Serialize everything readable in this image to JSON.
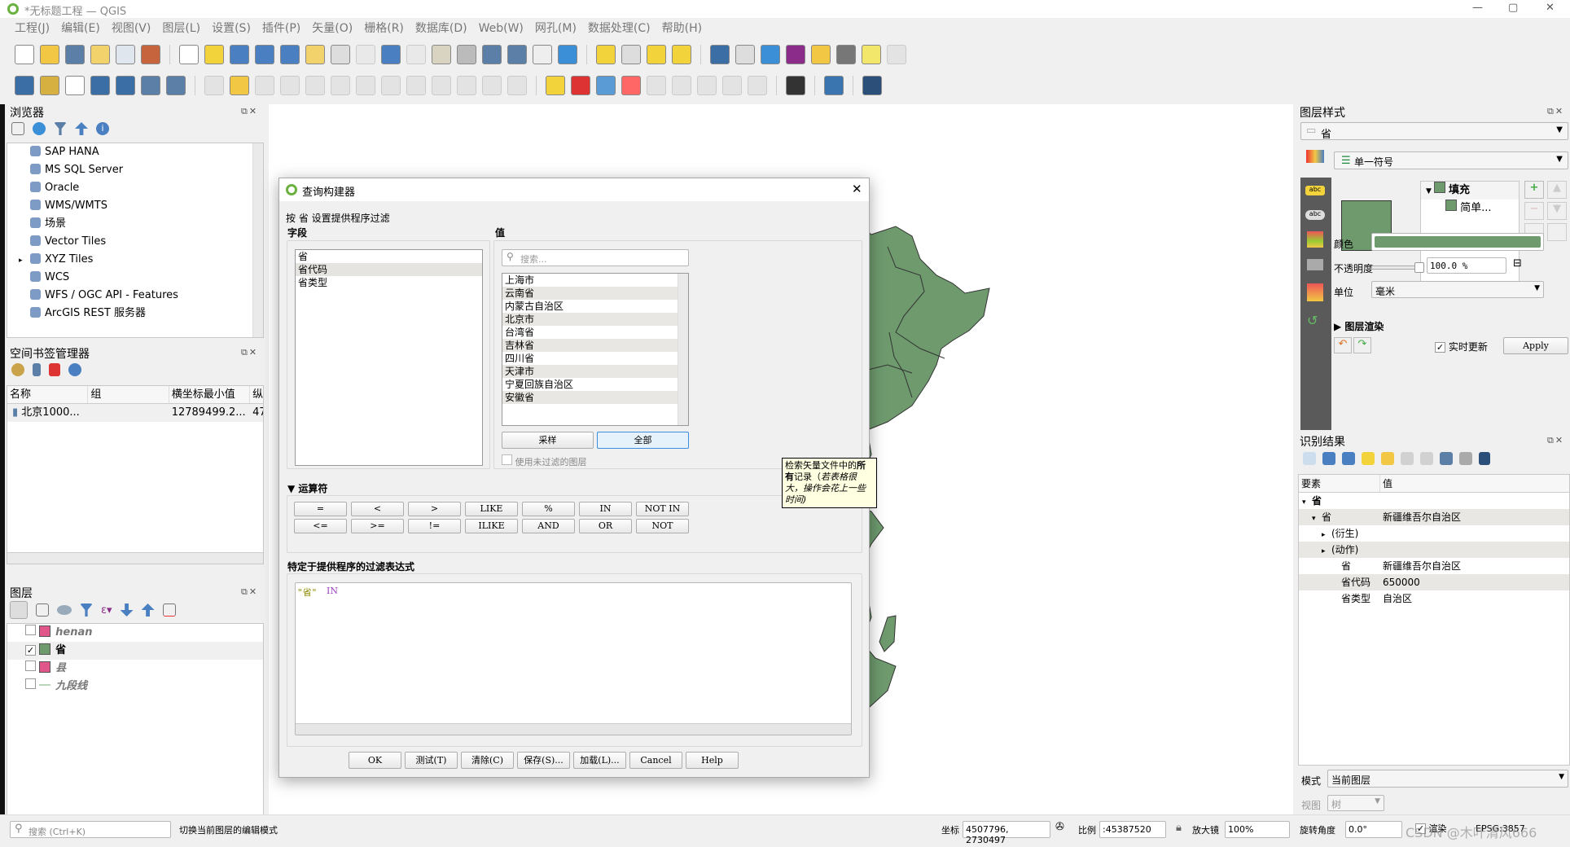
{
  "window": {
    "title": "*无标题工程 — QGIS",
    "minimize": "—",
    "maximize": "▢",
    "close": "✕"
  },
  "menu": [
    "工程(J)",
    "编辑(E)",
    "视图(V)",
    "图层(L)",
    "设置(S)",
    "插件(P)",
    "矢量(O)",
    "栅格(R)",
    "数据库(D)",
    "Web(W)",
    "网孔(M)",
    "数据处理(C)",
    "帮助(H)"
  ],
  "toolbar1": [
    {
      "icon": "new-project-icon",
      "color": "#fff"
    },
    {
      "icon": "open-project-icon",
      "color": "#f2c744"
    },
    {
      "icon": "save-project-icon",
      "color": "#5b7fa6"
    },
    {
      "icon": "new-print-layout-icon",
      "color": "#f2d36b"
    },
    {
      "icon": "layout-manager-icon",
      "color": "#dfe6ee"
    },
    {
      "icon": "style-manager-icon",
      "color": "#c6653d"
    },
    "sep",
    {
      "icon": "pan-icon",
      "color": "#fff"
    },
    {
      "icon": "pan-to-selection-icon",
      "color": "#f2d33c"
    },
    {
      "icon": "zoom-in-icon",
      "color": "#4a7fc1"
    },
    {
      "icon": "zoom-out-icon",
      "color": "#4a7fc1"
    },
    {
      "icon": "zoom-full-icon",
      "color": "#4a7fc1"
    },
    {
      "icon": "zoom-to-selection-icon",
      "color": "#f2d36b"
    },
    {
      "icon": "zoom-to-layer-icon",
      "color": "#ddd"
    },
    {
      "icon": "zoom-native-icon",
      "color": "#ddd",
      "dim": true
    },
    {
      "icon": "zoom-last-icon",
      "color": "#4a7fc1"
    },
    {
      "icon": "zoom-next-icon",
      "color": "#ddd",
      "dim": true
    },
    {
      "icon": "new-map-view-icon",
      "color": "#d9d3c1"
    },
    {
      "icon": "new-3d-view-icon",
      "color": "#bbb"
    },
    {
      "icon": "new-bookmark-icon",
      "color": "#5b7fa6"
    },
    {
      "icon": "show-bookmarks-icon",
      "color": "#5b7fa6"
    },
    {
      "icon": "temporal-controller-icon",
      "color": "#eee"
    },
    {
      "icon": "refresh-icon",
      "color": "#3a8fd6"
    },
    "sep",
    {
      "icon": "select-features-icon",
      "color": "#f2d33c"
    },
    {
      "icon": "attribute-table-icon",
      "color": "#ddd"
    },
    {
      "icon": "deselect-icon",
      "color": "#f2d33c"
    },
    {
      "icon": "select-by-location-icon",
      "color": "#f2d33c"
    },
    "sep",
    {
      "icon": "identify-icon",
      "color": "#3a6ea5"
    },
    {
      "icon": "open-table-icon",
      "color": "#ddd"
    },
    {
      "icon": "processing-toolbox-icon",
      "color": "#3a8fd6"
    },
    {
      "icon": "statistics-icon",
      "color": "#8b2c8b"
    },
    {
      "icon": "field-calculator-icon",
      "color": "#f2c744"
    },
    {
      "icon": "measure-icon",
      "color": "#777"
    },
    {
      "icon": "map-tips-icon",
      "color": "#f2e66b"
    },
    {
      "icon": "locator-icon",
      "color": "#ccc",
      "dim": true
    }
  ],
  "toolbar2": [
    {
      "icon": "data-source-manager-icon",
      "color": "#3a6ea5"
    },
    {
      "icon": "add-vector-layer-icon",
      "color": "#d6b040"
    },
    {
      "icon": "new-shapefile-icon",
      "color": "#fff"
    },
    {
      "icon": "new-geopackage-icon",
      "color": "#3a6ea5"
    },
    {
      "icon": "new-temp-layer-icon",
      "color": "#3a6ea5"
    },
    {
      "icon": "new-virtual-layer-icon",
      "color": "#5b7fa6"
    },
    {
      "icon": "new-spatialite-icon",
      "color": "#5b7fa6"
    },
    "sep",
    {
      "icon": "current-edits-icon",
      "color": "#ccc",
      "dim": true
    },
    {
      "icon": "toggle-editing-icon",
      "color": "#f2c744"
    },
    {
      "icon": "save-edits-icon",
      "color": "#ccc",
      "dim": true
    },
    {
      "icon": "digitize-icon",
      "color": "#ccc",
      "dim": true
    },
    {
      "icon": "add-polygon-icon",
      "color": "#ccc",
      "dim": true
    },
    {
      "icon": "vertex-tool-icon",
      "color": "#ccc",
      "dim": true
    },
    {
      "icon": "modify-attributes-icon",
      "color": "#ccc",
      "dim": true
    },
    {
      "icon": "delete-selected-icon",
      "color": "#ccc",
      "dim": true
    },
    {
      "icon": "cut-features-icon",
      "color": "#ccc",
      "dim": true
    },
    {
      "icon": "copy-features-icon",
      "color": "#ccc",
      "dim": true
    },
    {
      "icon": "paste-features-icon",
      "color": "#ccc",
      "dim": true
    },
    {
      "icon": "undo-icon",
      "color": "#ccc",
      "dim": true
    },
    {
      "icon": "redo-icon",
      "color": "#ccc",
      "dim": true
    },
    "sep",
    {
      "icon": "label-icon",
      "color": "#f2d33c"
    },
    {
      "icon": "diagram-icon",
      "color": "#d33"
    },
    {
      "icon": "pin-label-icon",
      "color": "#5b9bd5"
    },
    {
      "icon": "highlight-label-icon",
      "color": "#f66"
    },
    {
      "icon": "move-label-icon",
      "color": "#ccc",
      "dim": true
    },
    {
      "icon": "rotate-label-icon",
      "color": "#ccc",
      "dim": true
    },
    {
      "icon": "change-label-icon",
      "color": "#ccc",
      "dim": true
    },
    {
      "icon": "show-hide-labels-icon",
      "color": "#ccc",
      "dim": true
    },
    {
      "icon": "move-diagram-icon",
      "color": "#ccc",
      "dim": true
    },
    "sep",
    {
      "icon": "georeferencer-icon",
      "color": "#333"
    },
    "sep",
    {
      "icon": "python-console-icon",
      "color": "#3a75b0"
    },
    "sep",
    {
      "icon": "help-icon",
      "color": "#2c4f7a"
    }
  ],
  "browser": {
    "title": "浏览器",
    "items": [
      {
        "label": "SAP HANA",
        "icon": "sap-hana-icon"
      },
      {
        "label": "MS SQL Server",
        "icon": "mssql-icon"
      },
      {
        "label": "Oracle",
        "icon": "oracle-icon"
      },
      {
        "label": "WMS/WMTS",
        "icon": "wms-icon"
      },
      {
        "label": "场景",
        "icon": "scene-icon"
      },
      {
        "label": "Vector Tiles",
        "icon": "vector-tiles-icon"
      },
      {
        "label": "XYZ Tiles",
        "icon": "xyz-tiles-icon",
        "expandable": true
      },
      {
        "label": "WCS",
        "icon": "wcs-icon"
      },
      {
        "label": "WFS / OGC API - Features",
        "icon": "wfs-icon"
      },
      {
        "label": "ArcGIS REST 服务器",
        "icon": "arcgis-icon"
      }
    ]
  },
  "bookmarks": {
    "title": "空间书签管理器",
    "columns": [
      "名称",
      "组",
      "横坐标最小值",
      "纵"
    ],
    "rows": [
      {
        "name": "北京1000...",
        "group": "",
        "xmin": "12789499.2...",
        "y": "47"
      }
    ]
  },
  "layers": {
    "title": "图层",
    "items": [
      {
        "label": "henan",
        "checked": false,
        "color": "#e0568a",
        "italic": true
      },
      {
        "label": "省",
        "checked": true,
        "color": "#6e9a6e",
        "italic": false
      },
      {
        "label": "县",
        "checked": false,
        "color": "#e0568a",
        "italic": true
      },
      {
        "label": "九段线",
        "checked": false,
        "color": "line",
        "italic": true
      }
    ]
  },
  "dialog": {
    "title": "查询构建器",
    "subtitle": "按 省 设置提供程序过滤",
    "fields_label": "字段",
    "fields": [
      "省",
      "省代码",
      "省类型"
    ],
    "selected_field": 1,
    "values_label": "值",
    "search_placeholder": "搜索...",
    "values": [
      "上海市",
      "云南省",
      "内蒙古自治区",
      "北京市",
      "台湾省",
      "吉林省",
      "四川省",
      "天津市",
      "宁夏回族自治区",
      "安徽省"
    ],
    "sample_btn": "采样",
    "all_btn": "全部",
    "use_unfiltered": "使用未过滤的图层",
    "operators_label": "运算符",
    "operators": [
      "=",
      "<",
      ">",
      "LIKE",
      "%",
      "IN",
      "NOT IN",
      "<=",
      ">=",
      "!=",
      "ILIKE",
      "AND",
      "OR",
      "NOT"
    ],
    "expression_label": "特定于提供程序的过滤表达式",
    "expression_field": "\"省\"",
    "expression_op": "IN",
    "buttons": [
      "OK",
      "测试(T)",
      "清除(C)",
      "保存(S)...",
      "加载(L)...",
      "Cancel",
      "Help"
    ],
    "close": "✕"
  },
  "tooltip": {
    "normal": "检索矢量文件中的",
    "bold": "所有",
    "rest": "记录（",
    "italic": "若表格很大，操作会花上一些时间)"
  },
  "layer_style": {
    "title": "图层样式",
    "layer": "省",
    "renderer": "单一符号",
    "tree_root": "填充",
    "tree_child": "简单...",
    "fill_color": "#6e9a6e",
    "color_label": "颜色",
    "opacity_label": "不透明度",
    "opacity_value": "100.0 %",
    "opacity": 1.0,
    "unit_label": "单位",
    "unit_value": "毫米",
    "rendering_label": "图层渲染",
    "live_update": "实时更新",
    "live_update_checked": true,
    "apply": "Apply"
  },
  "identify": {
    "title": "识别结果",
    "columns": [
      "要素",
      "值"
    ],
    "rows": [
      {
        "k": "省",
        "v": "",
        "level": 0,
        "arrow": "▾",
        "bold": true
      },
      {
        "k": "省",
        "v": "新疆维吾尔自治区",
        "level": 1,
        "arrow": "▾"
      },
      {
        "k": "(衍生)",
        "v": "",
        "level": 2,
        "arrow": "▸"
      },
      {
        "k": "(动作)",
        "v": "",
        "level": 2,
        "arrow": "▸"
      },
      {
        "k": "省",
        "v": "新疆维吾尔自治区",
        "level": 3,
        "arrow": ""
      },
      {
        "k": "省代码",
        "v": "650000",
        "level": 3,
        "arrow": ""
      },
      {
        "k": "省类型",
        "v": "自治区",
        "level": 3,
        "arrow": ""
      }
    ],
    "mode_label": "模式",
    "mode_value": "当前图层",
    "view_label": "视图",
    "view_value": "树"
  },
  "statusbar": {
    "search_placeholder": "搜索 (Ctrl+K)",
    "message": "切换当前图层的编辑模式",
    "coord_label": "坐标",
    "coord_value": "4507796, 2730497",
    "scale_label": "比例",
    "scale_value": ":45387520",
    "magnifier_label": "放大镜",
    "magnifier_value": "100%",
    "rotation_label": "旋转角度",
    "rotation_value": "0.0°",
    "render_label": "渲染",
    "crs": "EPSG:3857",
    "watermark": "CSDN @木叶清风666"
  }
}
